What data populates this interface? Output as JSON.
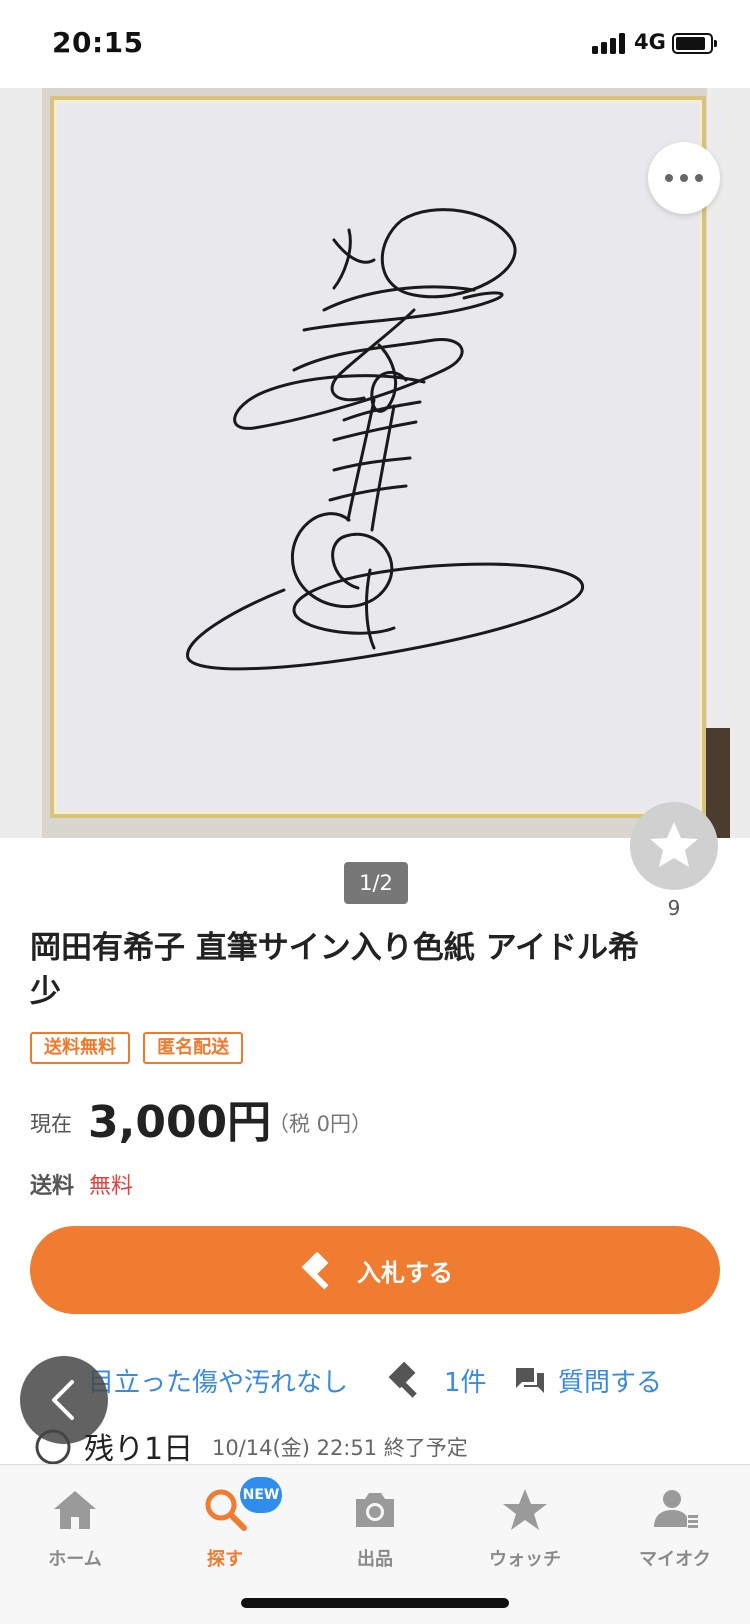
{
  "status_bar": {
    "time": "20:15",
    "network": "4G",
    "battery_level": 0.85
  },
  "gallery": {
    "pager": "1/2",
    "watch_count": "9"
  },
  "product": {
    "title": "岡田有希子 直筆サイン入り色紙 アイドル希少",
    "badges": [
      "送料無料",
      "匿名配送"
    ],
    "price_label": "現在",
    "price": "3,000円",
    "tax": "（税 0円）",
    "shipping_label": "送料",
    "shipping_value": "無料"
  },
  "actions": {
    "bid_label": "入札する"
  },
  "info": {
    "condition": "目立った傷や汚れなし",
    "bid_count": "1件",
    "question": "質問する",
    "remaining": "残り1日",
    "end_date": "10/14(金) 22:51 終了予定"
  },
  "bottom_nav": {
    "items": [
      {
        "label": "ホーム",
        "icon": "home-icon"
      },
      {
        "label": "探す",
        "icon": "search-icon",
        "badge": "NEW"
      },
      {
        "label": "出品",
        "icon": "camera-icon"
      },
      {
        "label": "ウォッチ",
        "icon": "star-icon"
      },
      {
        "label": "マイオク",
        "icon": "user-icon"
      }
    ]
  },
  "colors": {
    "accent": "#ef7c30",
    "link": "#3a8be0",
    "free_shipping": "#e3423c",
    "new_badge": "#2f8df0"
  }
}
